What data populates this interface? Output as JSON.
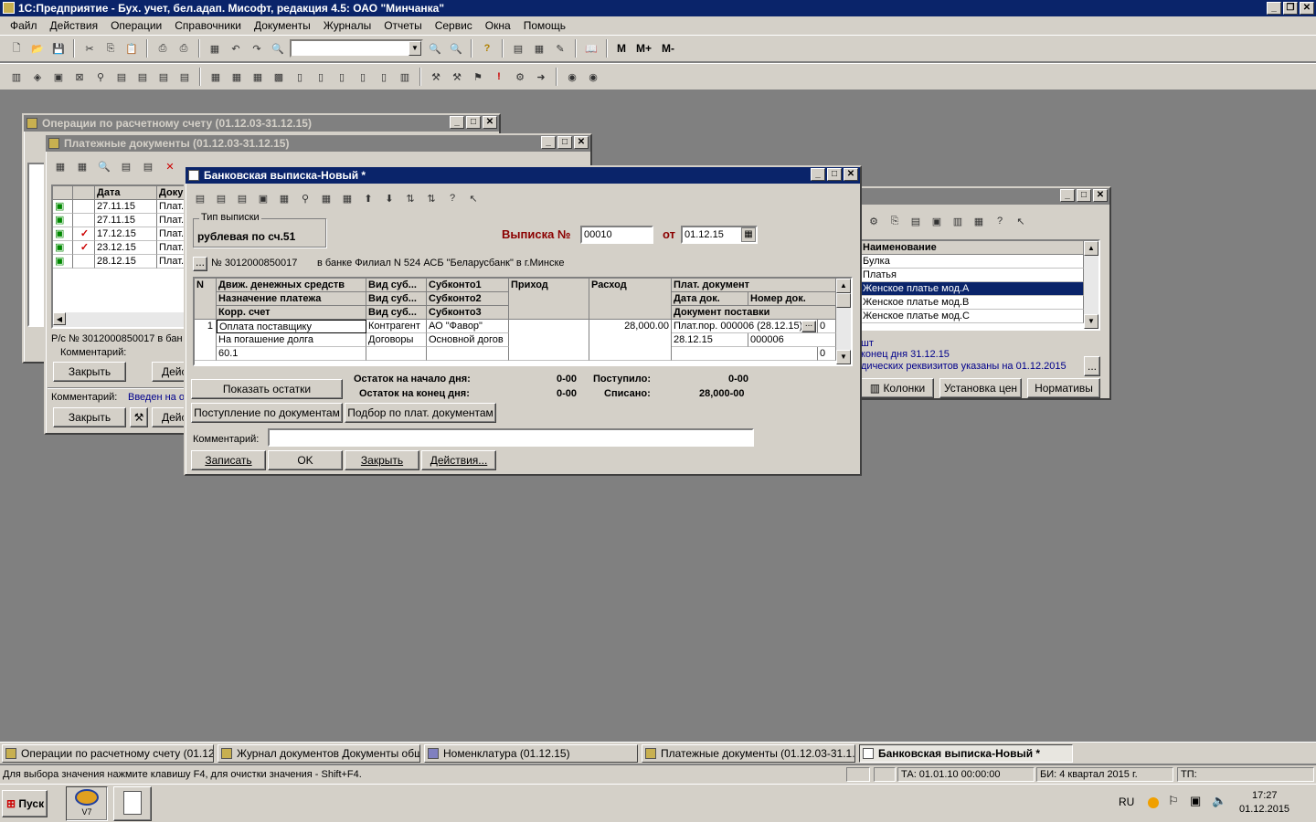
{
  "app": {
    "title": "1С:Предприятие - Бух. учет, бел.адап. Мисофт, редакция 4.5: ОАО \"Минчанка\""
  },
  "menu": [
    "Файл",
    "Действия",
    "Операции",
    "Справочники",
    "Документы",
    "Журналы",
    "Отчеты",
    "Сервис",
    "Окна",
    "Помощь"
  ],
  "toolbar1": {
    "m1": "M",
    "m2": "M+",
    "m3": "M-"
  },
  "win_ops": {
    "title": "Операции по расчетному счету (01.12.03-31.12.15)"
  },
  "win_pay": {
    "title": "Платежные документы (01.12.03-31.12.15)",
    "col_date": "Дата",
    "col_doc": "Доку",
    "rows": [
      {
        "date": "27.11.15",
        "doc": "Плат."
      },
      {
        "date": "27.11.15",
        "doc": "Плат."
      },
      {
        "date": "17.12.15",
        "doc": "Плат.",
        "check": "✓"
      },
      {
        "date": "23.12.15",
        "doc": "Плат.",
        "check": "✓"
      },
      {
        "date": "28.12.15",
        "doc": "Плат."
      }
    ],
    "rs": "Р/с № 3012000850017 в бан",
    "comment_label": "Комментарий:",
    "close": "Закрыть",
    "action": "Дейс",
    "comment2_label": "Комментарий:",
    "comment2_value": "Введен на о",
    "close2": "Закрыть",
    "action2": "Дейс"
  },
  "win_nom": {
    "col_name": "Наименование",
    "rows": [
      "Булка",
      "Платья",
      "Женское платье мод.А",
      "Женское платье мод.В",
      "Женское платье мод.С"
    ],
    "info1": "шт",
    "info2": "конец дня 31.12.15",
    "info3": "дических реквизитов указаны на 01.12.2015",
    "more": "...",
    "btn_cols": "Колонки",
    "btn_prices": "Установка цен",
    "btn_norms": "Нормативы"
  },
  "bank": {
    "title": "Банковская выписка-Новый *",
    "type_legend": "Тип выписки",
    "type_value": "рублевая по сч.51",
    "no_label": "Выписка №",
    "no_value": "00010",
    "from_label": "от",
    "from_value": "01.12.15",
    "account": "№ 3012000850017",
    "bank_name": "в банке Филиал N 524 АСБ \"Беларусбанк\" в г.Минске",
    "headers": {
      "n": "N",
      "h1a": "Движ. денежных средств",
      "h1b": "Назначение платежа",
      "h1c": "Корр. счет",
      "h2a": "Вид суб...",
      "h2b": "Вид суб...",
      "h2c": "Вид суб...",
      "h3a": "Субконто1",
      "h3b": "Субконто2",
      "h3c": "Субконто3",
      "h4": "Приход",
      "h5": "Расход",
      "h6a": "Плат. документ",
      "h6b": "Дата док.",
      "h6c": "Номер док.",
      "h6d": "Документ поставки"
    },
    "row": {
      "n": "1",
      "a1": "Оплата поставщику",
      "a2": "На погашение долга",
      "a3": "60.1",
      "b1": "Контрагент",
      "b2": "Договоры",
      "c1": "АО \"Фавор\"",
      "c2": "Основной догов",
      "out": "28,000.00",
      "d1": "Плат.пор. 000006 (28.12.15)",
      "d2": "28.12.15",
      "d3": "000006",
      "z1": "0",
      "z2": "0"
    },
    "btn_show": "Показать остатки",
    "start_label": "Остаток на начало дня:",
    "start_value": "0-00",
    "end_label": "Остаток на конец дня:",
    "end_value": "0-00",
    "in_label": "Поступило:",
    "in_value": "0-00",
    "out_label": "Списано:",
    "out_value": "28,000-00",
    "btn_receipt": "Поступление по документам",
    "btn_select": "Подбор по плат. документам",
    "comment_label": "Комментарий:",
    "btn_save": "Записать",
    "btn_ok": "OK",
    "btn_close": "Закрыть",
    "btn_actions": "Действия..."
  },
  "tasks": [
    "Операции по расчетному счету (01.12....",
    "Журнал документов  Документы обще...",
    "Номенклатура  (01.12.15)",
    "Платежные документы (01.12.03-31.1...",
    "Банковская выписка-Новый *"
  ],
  "status": {
    "hint": "Для выбора значения нажмите клавишу F4, для очистки значения - Shift+F4.",
    "ta": "ТА: 01.01.10  00:00:00",
    "bi": "БИ: 4 квартал 2015 г.",
    "tp": "ТП:"
  },
  "wintask": {
    "start": "Пуск",
    "lang": "RU",
    "time": "17:27",
    "date": "01.12.2015",
    "v7": "V7"
  }
}
